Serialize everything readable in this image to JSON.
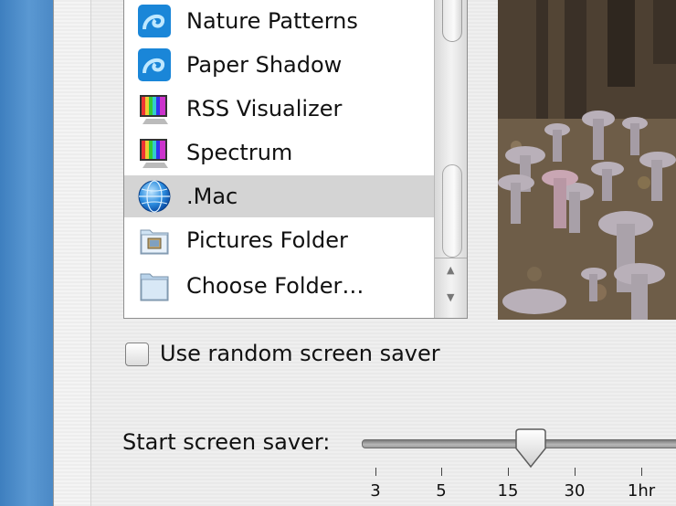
{
  "screensaver_list": {
    "items": [
      {
        "label": "Nature Patterns",
        "icon": "swirl-module-icon"
      },
      {
        "label": "Paper Shadow",
        "icon": "swirl-module-icon"
      },
      {
        "label": "RSS Visualizer",
        "icon": "color-bars-icon"
      },
      {
        "label": "Spectrum",
        "icon": "color-bars-icon"
      },
      {
        "label": ".Mac",
        "icon": "globe-icon",
        "selected": true
      },
      {
        "label": "Pictures Folder",
        "icon": "pictures-folder-icon"
      },
      {
        "label": "Choose Folder…",
        "icon": "folder-icon"
      }
    ]
  },
  "random_checkbox": {
    "label": "Use random screen saver",
    "checked": false
  },
  "start_slider": {
    "label": "Start screen saver:",
    "ticks": [
      "3",
      "5",
      "15",
      "30",
      "1hr"
    ],
    "value_fraction": 0.5
  }
}
